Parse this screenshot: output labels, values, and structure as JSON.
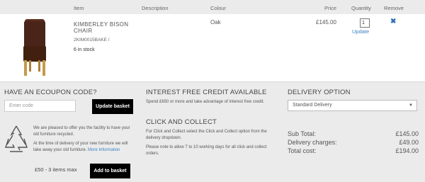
{
  "table_header": {
    "item": "Item",
    "description": "Description",
    "colour": "Colour",
    "price": "Price",
    "quantity": "Quantity",
    "remove": "Remove"
  },
  "product": {
    "name": "KIMBERLEY BISON CHAIR",
    "sku": "2KIM0015BAKE /",
    "stock": "6 in stock",
    "colour": "Oak",
    "price": "£145.00",
    "quantity": "1",
    "update_label": "Update",
    "remove_icon": "close-icon"
  },
  "ecoupon": {
    "heading": "HAVE AN ECOUPON CODE?",
    "placeholder": "Enter code",
    "button": "Update basket"
  },
  "recycle": {
    "icon": "recycle-icon",
    "text1": "We are pleased to offer you the facility to have your old furniture recycled.",
    "text2": "At the time of delivery of your new furniture we will take away your old furniture.",
    "more_link": "More Information",
    "price_text": "£50 - 3 items max",
    "button": "Add to basket"
  },
  "credit": {
    "heading": "INTEREST FREE CREDIT AVAILABLE",
    "text": "Spend £650 or more and take advantage of interest free credit."
  },
  "click_collect": {
    "heading": "CLICK AND COLLECT",
    "text1": "For Click and Collect select the Click and Collect option from the delivery dropdown.",
    "text2": "Please note to allow 7 to 10 working days for all click and collect orders."
  },
  "delivery": {
    "heading": "DELIVERY OPTION",
    "selected": "Standard Delivery"
  },
  "totals": {
    "subtotal_label": "Sub Total:",
    "subtotal_value": "£145.00",
    "delivery_label": "Delivery charges:",
    "delivery_value": "£49.00",
    "total_label": "Total cost:",
    "total_value": "£194.00"
  },
  "colors": {
    "link": "#3b80c6",
    "chair": "#4a2418",
    "background": "#ebebeb"
  }
}
